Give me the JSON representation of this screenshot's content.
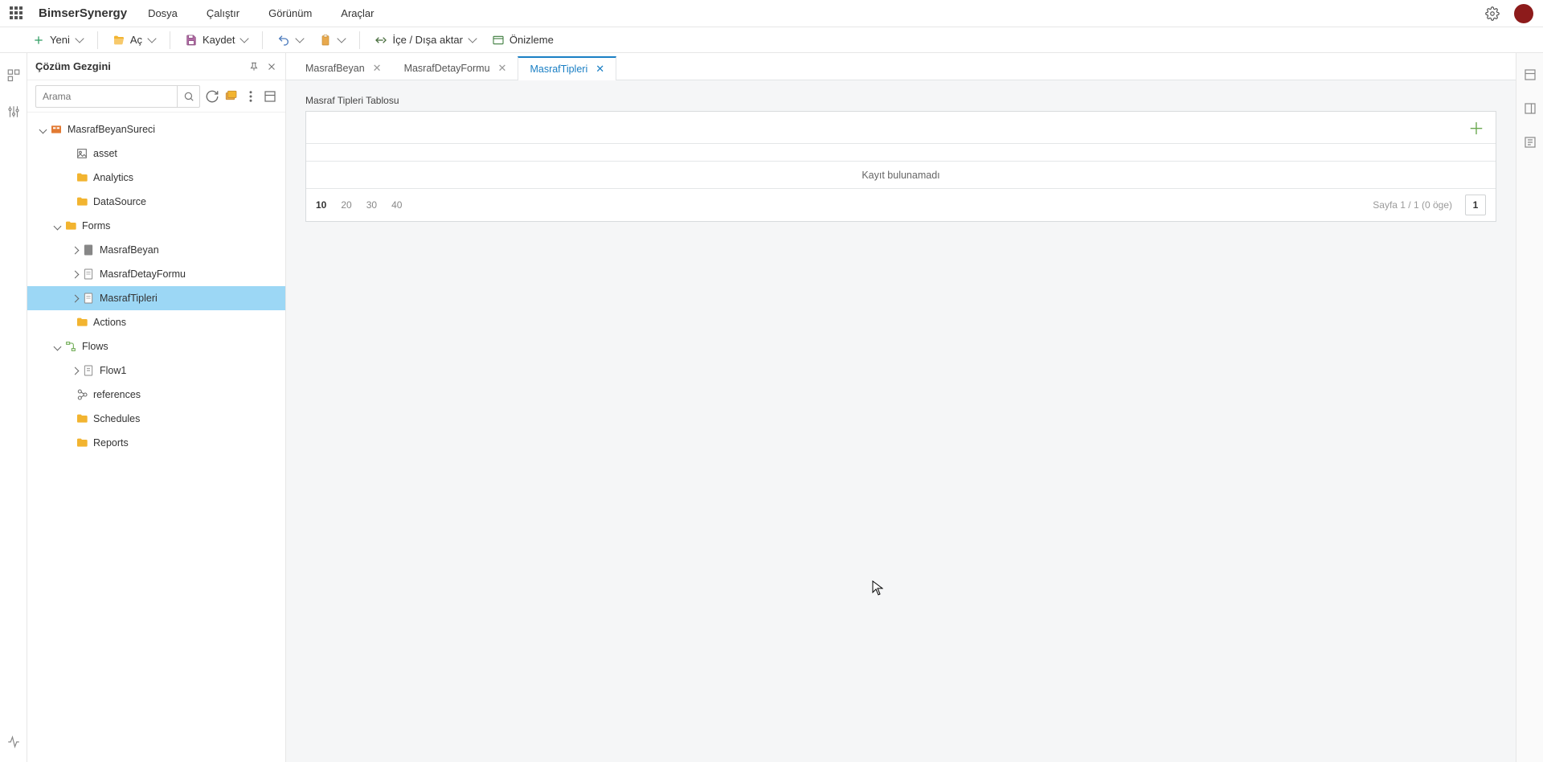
{
  "brand": "BimserSynergy",
  "menu": {
    "file": "Dosya",
    "run": "Çalıştır",
    "view": "Görünüm",
    "tools": "Araçlar"
  },
  "toolbar": {
    "new": "Yeni",
    "open": "Aç",
    "save": "Kaydet",
    "importExport": "İçe / Dışa aktar",
    "preview": "Önizleme"
  },
  "explorer": {
    "title": "Çözüm Gezgini",
    "searchPlaceholder": "Arama",
    "tree": {
      "root": "MasrafBeyanSureci",
      "asset": "asset",
      "analytics": "Analytics",
      "datasource": "DataSource",
      "forms": "Forms",
      "form1": "MasrafBeyan",
      "form2": "MasrafDetayFormu",
      "form3": "MasrafTipleri",
      "actions": "Actions",
      "flows": "Flows",
      "flow1": "Flow1",
      "references": "references",
      "schedules": "Schedules",
      "reports": "Reports"
    }
  },
  "tabs": {
    "t1": "MasrafBeyan",
    "t2": "MasrafDetayFormu",
    "t3": "MasrafTipleri"
  },
  "table": {
    "title": "Masraf Tipleri Tablosu",
    "empty": "Kayıt bulunamadı",
    "sizes": {
      "s10": "10",
      "s20": "20",
      "s30": "30",
      "s40": "40"
    },
    "pageInfo": "Sayfa 1 / 1 (0 öge)",
    "pageCurrent": "1"
  }
}
